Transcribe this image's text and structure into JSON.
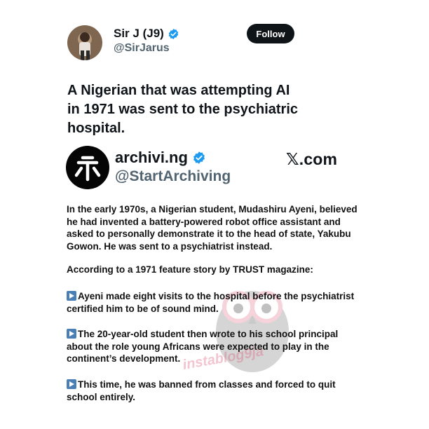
{
  "tweet": {
    "display_name": "Sir J (J9)",
    "handle": "@SirJarus",
    "follow_label": "Follow",
    "text_lines": [
      "A Nigerian that was attempting AI",
      "in 1971 was sent to the psychiatric",
      "hospital."
    ]
  },
  "card": {
    "display_name": "archivi.ng",
    "handle": "@StartArchiving",
    "site": "𝕏.com",
    "paragraphs": [
      [
        "In the early 1970s, a Nigerian student, Mudashiru Ayeni, believed",
        "he had invented a battery-powered robot office assistant and",
        "asked to personally demonstrate it to the head of state, Yakubu",
        "Gowon. He was sent to a psychiatrist instead."
      ],
      [
        "According to a 1971 feature story by TRUST magazine:"
      ],
      [
        "Ayeni made eight visits to the hospital before the psychiatrist",
        "certified him to be of sound mind."
      ],
      [
        "The 20-year-old student then wrote to his school principal",
        "about the role young Africans were expected to play in the",
        "continent’s development."
      ],
      [
        "This time, he was banned from classes and forced to quit",
        "school entirely."
      ]
    ]
  },
  "watermark": "instablog9ja",
  "colors": {
    "verified_blue": "#1d9bf0",
    "button_bg": "#0f1419",
    "handle_gray": "#536471",
    "play_icon_blue": "#4a7fb5"
  }
}
